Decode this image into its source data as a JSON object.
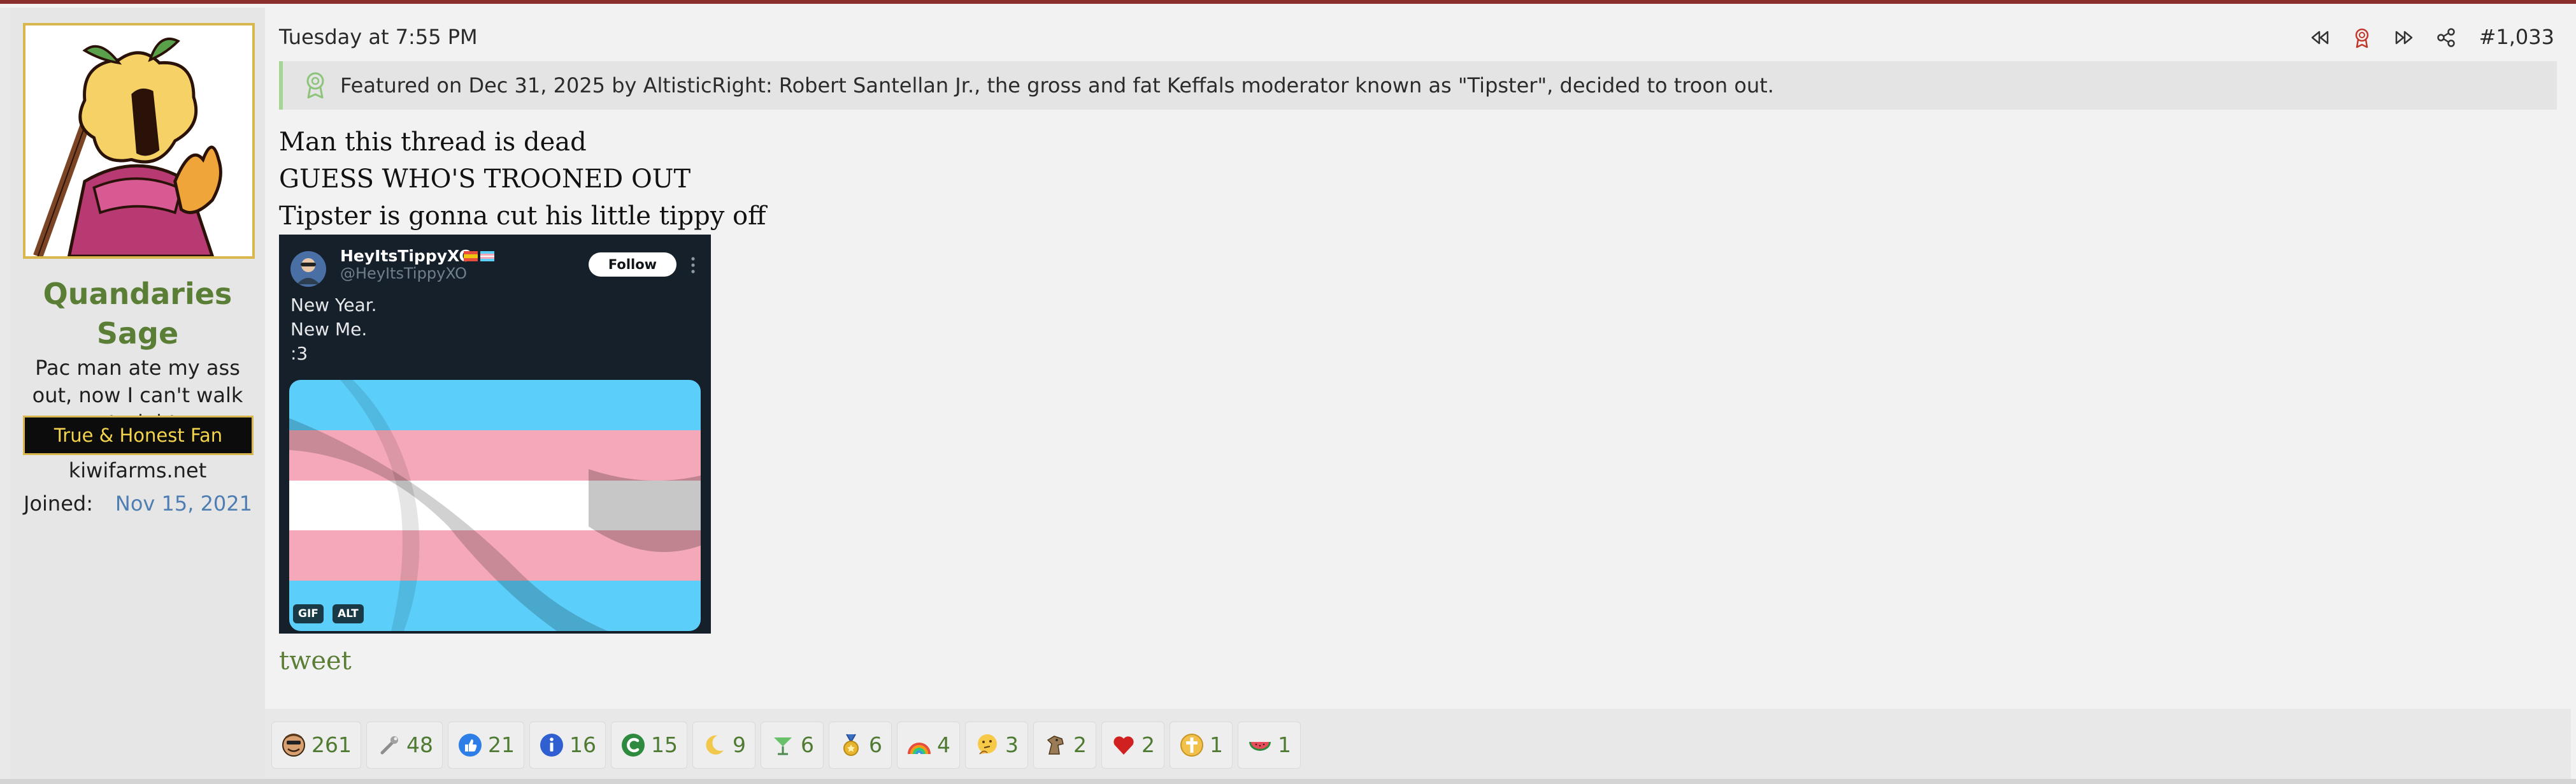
{
  "post": {
    "timestamp": "Tuesday at 7:55 PM",
    "number": "#1,033",
    "featured": "Featured on Dec 31, 2025 by AltisticRight: Robert Santellan Jr., the gross and fat Keffals moderator known as \"Tipster\", decided to troon out.",
    "body_lines": [
      "Man this thread is dead",
      "GUESS WHO'S TROONED OUT",
      "Tipster is gonna cut his little tippy off"
    ],
    "link_text": "tweet"
  },
  "user": {
    "name": "Quandaries Sage",
    "title": "Pac man ate my ass out, now I can't walk straight",
    "banner": "True & Honest Fan",
    "site": "kiwifarms.net",
    "joined_label": "Joined:",
    "joined_date": "Nov 15, 2021"
  },
  "embed": {
    "display_name": "HeyItsTippyXO",
    "handle": "@HeyItsTippyXO",
    "follow_label": "Follow",
    "text_lines": [
      "New Year.",
      "New Me.",
      ":3"
    ],
    "badges": [
      "GIF",
      "ALT"
    ]
  },
  "reactions": [
    {
      "icon": "face-emoji-icon",
      "count": "261"
    },
    {
      "icon": "wrench-icon",
      "count": "48"
    },
    {
      "icon": "thumbs-up-icon",
      "count": "21"
    },
    {
      "icon": "info-icon",
      "count": "16"
    },
    {
      "icon": "green-c-icon",
      "count": "15"
    },
    {
      "icon": "crescent-moon-icon",
      "count": "9"
    },
    {
      "icon": "cocktail-icon",
      "count": "6"
    },
    {
      "icon": "medal-icon",
      "count": "6"
    },
    {
      "icon": "rainbow-icon",
      "count": "4"
    },
    {
      "icon": "thinking-face-icon",
      "count": "3"
    },
    {
      "icon": "horse-icon",
      "count": "2"
    },
    {
      "icon": "heart-icon",
      "count": "2"
    },
    {
      "icon": "gold-cross-icon",
      "count": "1"
    },
    {
      "icon": "watermelon-icon",
      "count": "1"
    }
  ],
  "colors": {
    "accent_green": "#5a7e36",
    "featured_bar": "#a7d596",
    "top_border": "#8b2e2e",
    "banner_gold": "#d8b74e"
  }
}
